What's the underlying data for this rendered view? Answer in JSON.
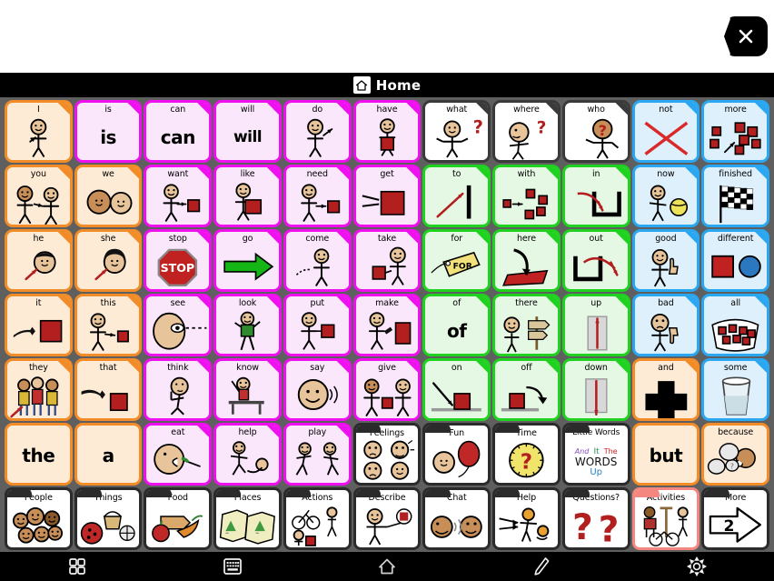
{
  "header": {
    "title": "Home",
    "home_icon": "home-icon",
    "close_icon": "close-x-icon"
  },
  "grid": {
    "columns": 11,
    "rows": 7
  },
  "cells": [
    {
      "label": "I",
      "style": "orange",
      "art": "person-point-self"
    },
    {
      "label": "is",
      "style": "mag",
      "art": "text",
      "big": "is"
    },
    {
      "label": "can",
      "style": "mag",
      "art": "text",
      "big": "can"
    },
    {
      "label": "will",
      "style": "mag",
      "art": "text",
      "big": "will"
    },
    {
      "label": "do",
      "style": "mag",
      "art": "person-do"
    },
    {
      "label": "have",
      "style": "mag",
      "art": "person-hold-red"
    },
    {
      "label": "what",
      "style": "white",
      "art": "person-question"
    },
    {
      "label": "where",
      "style": "white",
      "art": "person-look-question"
    },
    {
      "label": "who",
      "style": "white",
      "art": "person-face-question"
    },
    {
      "label": "not",
      "style": "blue",
      "art": "red-x"
    },
    {
      "label": "more",
      "style": "blue",
      "art": "blocks-more"
    },
    {
      "label": "you",
      "style": "orange",
      "art": "two-people-point"
    },
    {
      "label": "we",
      "style": "orange",
      "art": "two-faces"
    },
    {
      "label": "want",
      "style": "mag",
      "art": "person-reach-red"
    },
    {
      "label": "like",
      "style": "mag",
      "art": "person-hug-red"
    },
    {
      "label": "need",
      "style": "mag",
      "art": "person-need-red"
    },
    {
      "label": "get",
      "style": "mag",
      "art": "hands-red-block"
    },
    {
      "label": "to",
      "style": "green",
      "art": "arrow-to-bar"
    },
    {
      "label": "with",
      "style": "green",
      "art": "blocks-with"
    },
    {
      "label": "in",
      "style": "green",
      "art": "arrow-into-u"
    },
    {
      "label": "now",
      "style": "blue",
      "art": "person-ball"
    },
    {
      "label": "finished",
      "style": "blue",
      "art": "checkered-flag"
    },
    {
      "label": "he",
      "style": "orange",
      "art": "boy-face-arrow"
    },
    {
      "label": "she",
      "style": "orange",
      "art": "girl-face-arrow"
    },
    {
      "label": "stop",
      "style": "mag",
      "art": "stop-sign"
    },
    {
      "label": "go",
      "style": "mag",
      "art": "green-arrow"
    },
    {
      "label": "come",
      "style": "mag",
      "art": "person-come"
    },
    {
      "label": "take",
      "style": "mag",
      "art": "person-take-red"
    },
    {
      "label": "for",
      "style": "green",
      "art": "for-tag"
    },
    {
      "label": "here",
      "style": "green",
      "art": "arrow-down-mat"
    },
    {
      "label": "out",
      "style": "green",
      "art": "arrow-out-u"
    },
    {
      "label": "good",
      "style": "blue",
      "art": "thumbs-up-person"
    },
    {
      "label": "different",
      "style": "blue",
      "art": "square-circle"
    },
    {
      "label": "it",
      "style": "orange",
      "art": "hand-point-red"
    },
    {
      "label": "this",
      "style": "orange",
      "art": "person-point-red"
    },
    {
      "label": "see",
      "style": "mag",
      "art": "eye-sight"
    },
    {
      "label": "look",
      "style": "mag",
      "art": "person-walk-look"
    },
    {
      "label": "put",
      "style": "mag",
      "art": "person-put-red"
    },
    {
      "label": "make",
      "style": "mag",
      "art": "person-hammer-red"
    },
    {
      "label": "of",
      "style": "green",
      "art": "text",
      "big": "of"
    },
    {
      "label": "there",
      "style": "green",
      "art": "person-signpost"
    },
    {
      "label": "up",
      "style": "green",
      "art": "arrow-up-block"
    },
    {
      "label": "bad",
      "style": "blue",
      "art": "thumbs-down-person"
    },
    {
      "label": "all",
      "style": "blue",
      "art": "blocks-all-bag"
    },
    {
      "label": "they",
      "style": "orange",
      "art": "three-people-arrow"
    },
    {
      "label": "that",
      "style": "orange",
      "art": "hand-point-far-red"
    },
    {
      "label": "think",
      "style": "mag",
      "art": "person-think"
    },
    {
      "label": "know",
      "style": "mag",
      "art": "person-raise-hand-desk"
    },
    {
      "label": "say",
      "style": "mag",
      "art": "face-talk"
    },
    {
      "label": "give",
      "style": "mag",
      "art": "two-people-give-red"
    },
    {
      "label": "on",
      "style": "green",
      "art": "block-on-line"
    },
    {
      "label": "off",
      "style": "green",
      "art": "block-off-line"
    },
    {
      "label": "down",
      "style": "green",
      "art": "arrow-down-block"
    },
    {
      "label": "and",
      "style": "orange",
      "art": "plus-sign"
    },
    {
      "label": "some",
      "style": "blue",
      "art": "glass-half"
    },
    {
      "label": "",
      "style": "plain",
      "art": "text",
      "big": "the"
    },
    {
      "label": "",
      "style": "plain",
      "art": "text",
      "big": "a"
    },
    {
      "label": "eat",
      "style": "mag",
      "art": "person-eat"
    },
    {
      "label": "help",
      "style": "mag",
      "art": "person-help"
    },
    {
      "label": "play",
      "style": "mag",
      "art": "person-play"
    },
    {
      "label": "Feelings",
      "style": "folder",
      "art": "four-faces"
    },
    {
      "label": "Fun",
      "style": "folder",
      "art": "face-balloon"
    },
    {
      "label": "Time",
      "style": "folder",
      "art": "clock-question"
    },
    {
      "label": "Little Words",
      "style": "folder",
      "art": "little-words"
    },
    {
      "label": "",
      "style": "plain",
      "art": "text",
      "big": "but"
    },
    {
      "label": "because",
      "style": "plain",
      "art": "speech-bubbles"
    },
    {
      "label": "People",
      "style": "folder",
      "art": "many-faces"
    },
    {
      "label": "Things",
      "style": "folder",
      "art": "ball-basket-fan"
    },
    {
      "label": "Food",
      "style": "folder",
      "art": "bread-apple-carrot"
    },
    {
      "label": "Places",
      "style": "folder",
      "art": "two-maps"
    },
    {
      "label": "Actions",
      "style": "folder",
      "art": "bike-walk-person"
    },
    {
      "label": "Describe",
      "style": "folder",
      "art": "person-describe-red"
    },
    {
      "label": "Chat",
      "style": "folder",
      "art": "two-faces-talk"
    },
    {
      "label": "Help",
      "style": "folder",
      "art": "person-helping"
    },
    {
      "label": "Questions?",
      "style": "folder",
      "art": "double-question"
    },
    {
      "label": "Activities",
      "style": "folder-selected",
      "art": "activities-people"
    },
    {
      "label": "More",
      "style": "folder-plain",
      "art": "arrow-more-2",
      "badge": "2"
    }
  ],
  "little_words": {
    "l1": "And",
    "l2": "It",
    "l3": "The",
    "l4": "WORDS",
    "l5": "Up"
  },
  "navbar": {
    "items": [
      {
        "name": "grid-icon",
        "label": "grid"
      },
      {
        "name": "keyboard-icon",
        "label": "keyboard"
      },
      {
        "name": "home-icon",
        "label": "home"
      },
      {
        "name": "pencil-icon",
        "label": "pencil"
      },
      {
        "name": "gear-icon",
        "label": "settings"
      }
    ]
  },
  "colors": {
    "orange": "#F28C28",
    "magenta": "#EE10EE",
    "green": "#1FD21F",
    "blue": "#2AA7F0",
    "white_border": "#3A3A3A",
    "selected": "#F4877F",
    "board_bg": "#5F5F5F",
    "red": "#B31E1E"
  }
}
